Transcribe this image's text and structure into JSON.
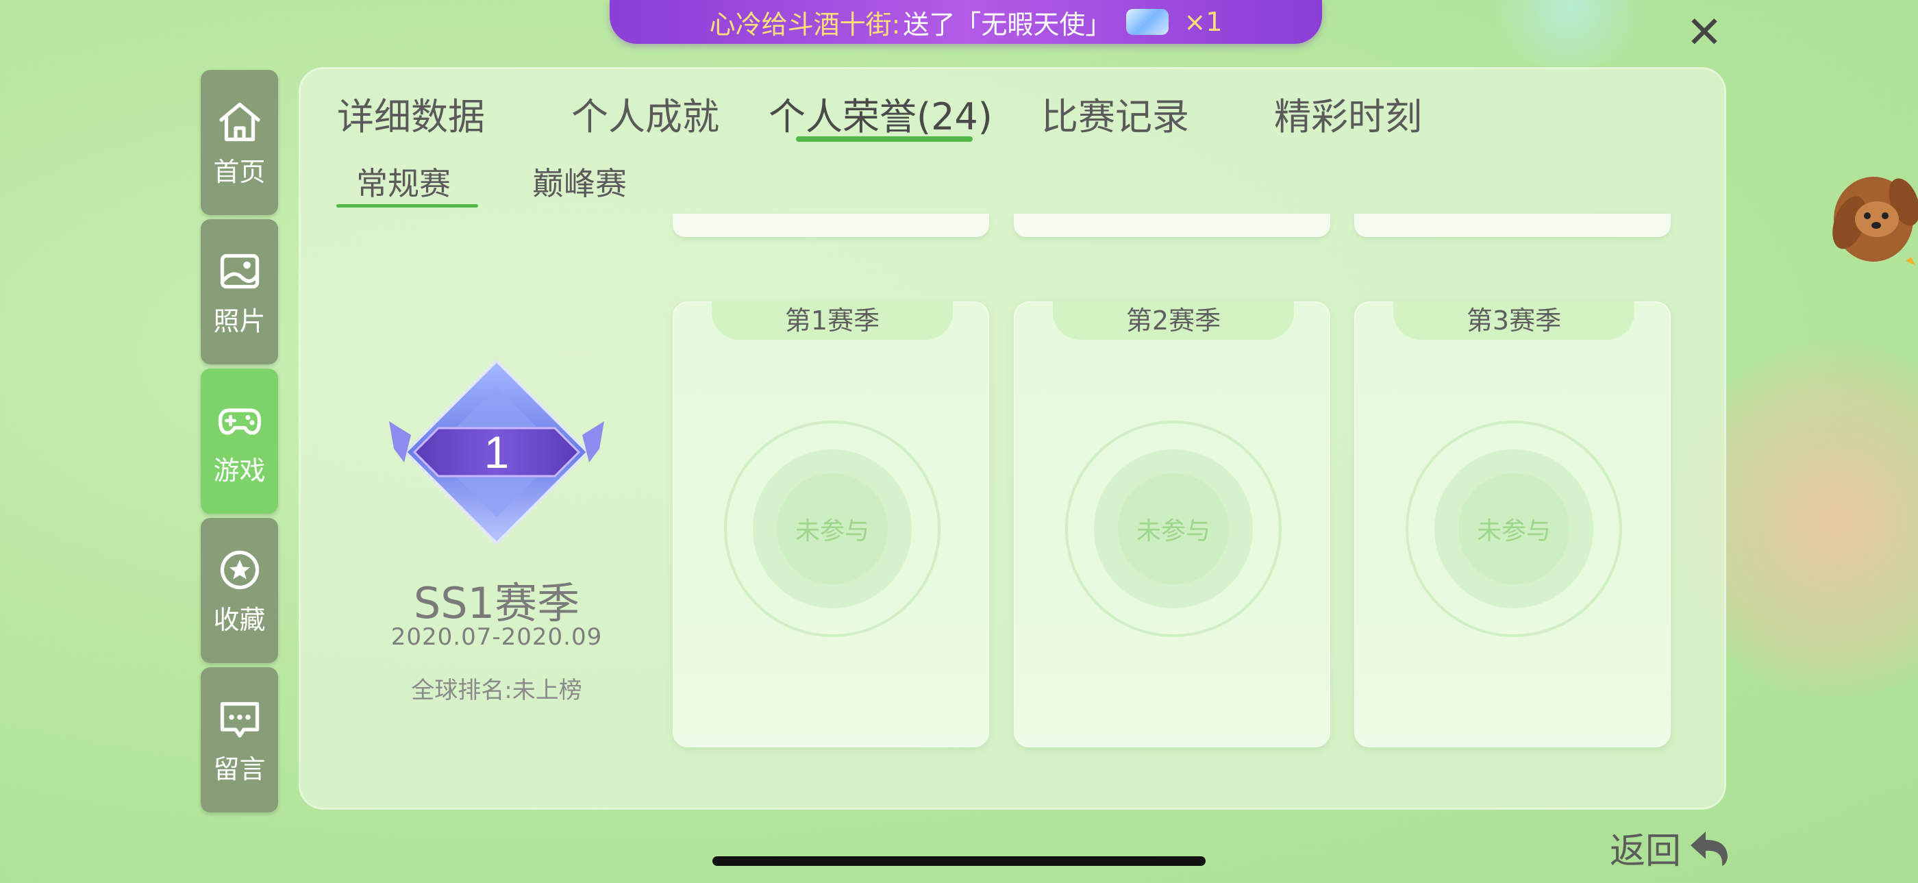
{
  "banner": {
    "sender": "心冷给斗酒十街:",
    "message": "送了「无暇天使」",
    "count": "×1"
  },
  "sidebar": {
    "items": [
      {
        "label": "首页",
        "icon": "home-icon",
        "active": false
      },
      {
        "label": "照片",
        "icon": "photo-icon",
        "active": false
      },
      {
        "label": "游戏",
        "icon": "gamepad-icon",
        "active": true
      },
      {
        "label": "收藏",
        "icon": "star-icon",
        "active": false
      },
      {
        "label": "留言",
        "icon": "message-icon",
        "active": false
      }
    ]
  },
  "tabs": [
    {
      "label": "详细数据"
    },
    {
      "label": "个人成就"
    },
    {
      "label": "个人荣誉(24)",
      "active": true
    },
    {
      "label": "比赛记录"
    },
    {
      "label": "精彩时刻"
    }
  ],
  "subtabs": [
    {
      "label": "常规赛",
      "active": true
    },
    {
      "label": "巅峰赛"
    }
  ],
  "season": {
    "badge_number": "1",
    "title": "SS1赛季",
    "dates": "2020.07-2020.09",
    "rank": "全球排名:未上榜"
  },
  "season_cards": [
    {
      "title": "第1赛季",
      "status": "未参与"
    },
    {
      "title": "第2赛季",
      "status": "未参与"
    },
    {
      "title": "第3赛季",
      "status": "未参与"
    }
  ],
  "back": {
    "label": "返回"
  },
  "colors": {
    "accent": "#52b848",
    "sidebar_active": "#7dd36a",
    "sidebar": "#889e79",
    "banner": "#a44fe0"
  }
}
